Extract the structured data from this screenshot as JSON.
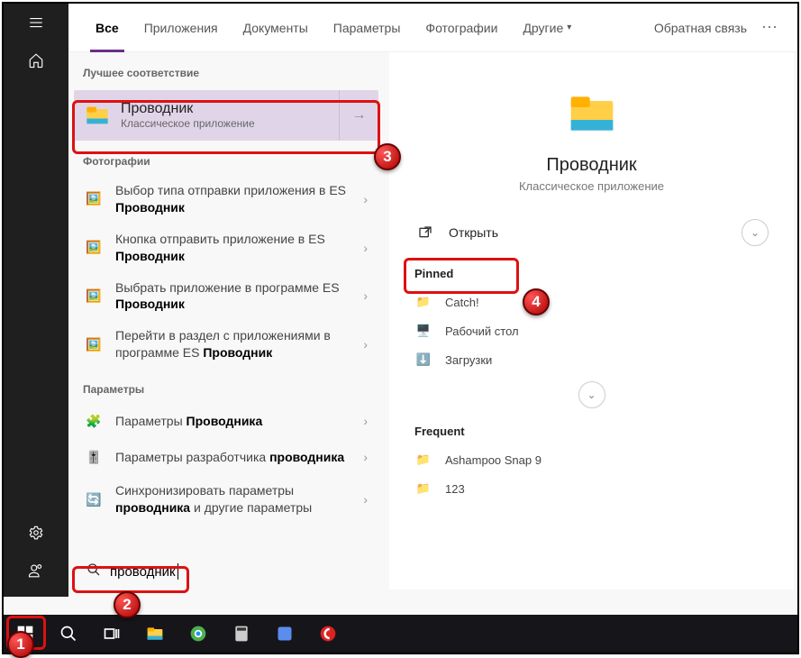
{
  "nav": {
    "tabs": [
      "Все",
      "Приложения",
      "Документы",
      "Параметры",
      "Фотографии"
    ],
    "more": "Другие",
    "feedback": "Обратная связь"
  },
  "sections": {
    "best": "Лучшее соответствие",
    "photos": "Фотографии",
    "params": "Параметры"
  },
  "bestMatch": {
    "title": "Проводник",
    "subtitle": "Классическое приложение"
  },
  "photoResults": [
    {
      "pre": "Выбор типа отправки приложения в ES ",
      "bold": "Проводник"
    },
    {
      "pre": "Кнопка отправить приложение в ES ",
      "bold": "Проводник"
    },
    {
      "pre": "Выбрать приложение в программе ES ",
      "bold": "Проводник"
    },
    {
      "pre": "Перейти в раздел с приложениями в программе ES ",
      "bold": "Проводник"
    }
  ],
  "paramResults": [
    {
      "pre": "Параметры ",
      "bold": "Проводника"
    },
    {
      "pre1": "Параметры разработчика ",
      "bold1": "проводника"
    },
    {
      "pre2": "Синхронизировать параметры ",
      "bold2": "проводника",
      "post2": " и другие параметры"
    }
  ],
  "detail": {
    "title": "Проводник",
    "subtitle": "Классическое приложение",
    "open": "Открыть",
    "pinnedHdr": "Pinned",
    "pinned": [
      "Catch!",
      "Рабочий стол",
      "Загрузки"
    ],
    "freqHdr": "Frequent",
    "frequent": [
      "Ashampoo Snap 9",
      "123"
    ]
  },
  "search": {
    "query": "проводник"
  },
  "badges": {
    "b1": "1",
    "b2": "2",
    "b3": "3",
    "b4": "4"
  }
}
